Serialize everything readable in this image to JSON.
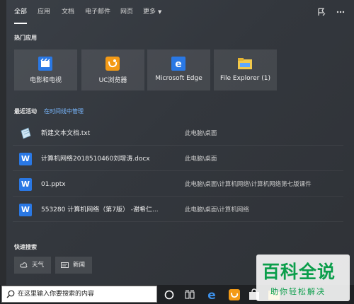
{
  "tabs": [
    {
      "label": "全部",
      "active": true
    },
    {
      "label": "应用"
    },
    {
      "label": "文档"
    },
    {
      "label": "电子邮件"
    },
    {
      "label": "网页"
    },
    {
      "label": "更多"
    }
  ],
  "top_icons": [
    "feedback-icon",
    "more-options-icon"
  ],
  "hot_apps": {
    "title": "热门应用",
    "items": [
      {
        "label": "电影和电视",
        "icon": "movies-tv-icon"
      },
      {
        "label": "UC浏览器",
        "icon": "uc-browser-icon"
      },
      {
        "label": "Microsoft Edge",
        "icon": "edge-icon"
      },
      {
        "label": "File Explorer (1)",
        "icon": "file-explorer-icon"
      }
    ]
  },
  "recent": {
    "title": "最近活动",
    "link": "在时间线中管理",
    "items": [
      {
        "name": "新建文本文档.txt",
        "path": "此电脑\\桌面",
        "icon": "text-file-icon"
      },
      {
        "name": "计算机网络2018510460刘增涛.docx",
        "path": "此电脑\\桌面",
        "icon": "wps-doc-icon"
      },
      {
        "name": "01.pptx",
        "path": "此电脑\\桌面\\计算机网络\\计算机网络第七版课件",
        "icon": "wps-doc-icon"
      },
      {
        "name": "553280 计算机网络（第7版） -谢希仁...",
        "path": "此电脑\\桌面\\计算机网络",
        "icon": "wps-doc-icon"
      }
    ]
  },
  "quick_search": {
    "title": "快速搜索",
    "items": [
      {
        "label": "天气",
        "icon": "weather-icon"
      },
      {
        "label": "新闻",
        "icon": "news-icon"
      }
    ]
  },
  "taskbar": {
    "search_placeholder": "在这里输入你要搜索的内容",
    "icons": [
      "cortana-icon",
      "task-view-icon",
      "edge-icon",
      "uc-browser-icon",
      "store-icon",
      "explorer-icon"
    ]
  },
  "watermark": {
    "big": "百科全说",
    "small": "助你轻松解决"
  },
  "colors": {
    "accent": "#2a78e4",
    "link": "#79b8ff",
    "panel": "#363a40",
    "watermark": "#0b9e4b"
  }
}
